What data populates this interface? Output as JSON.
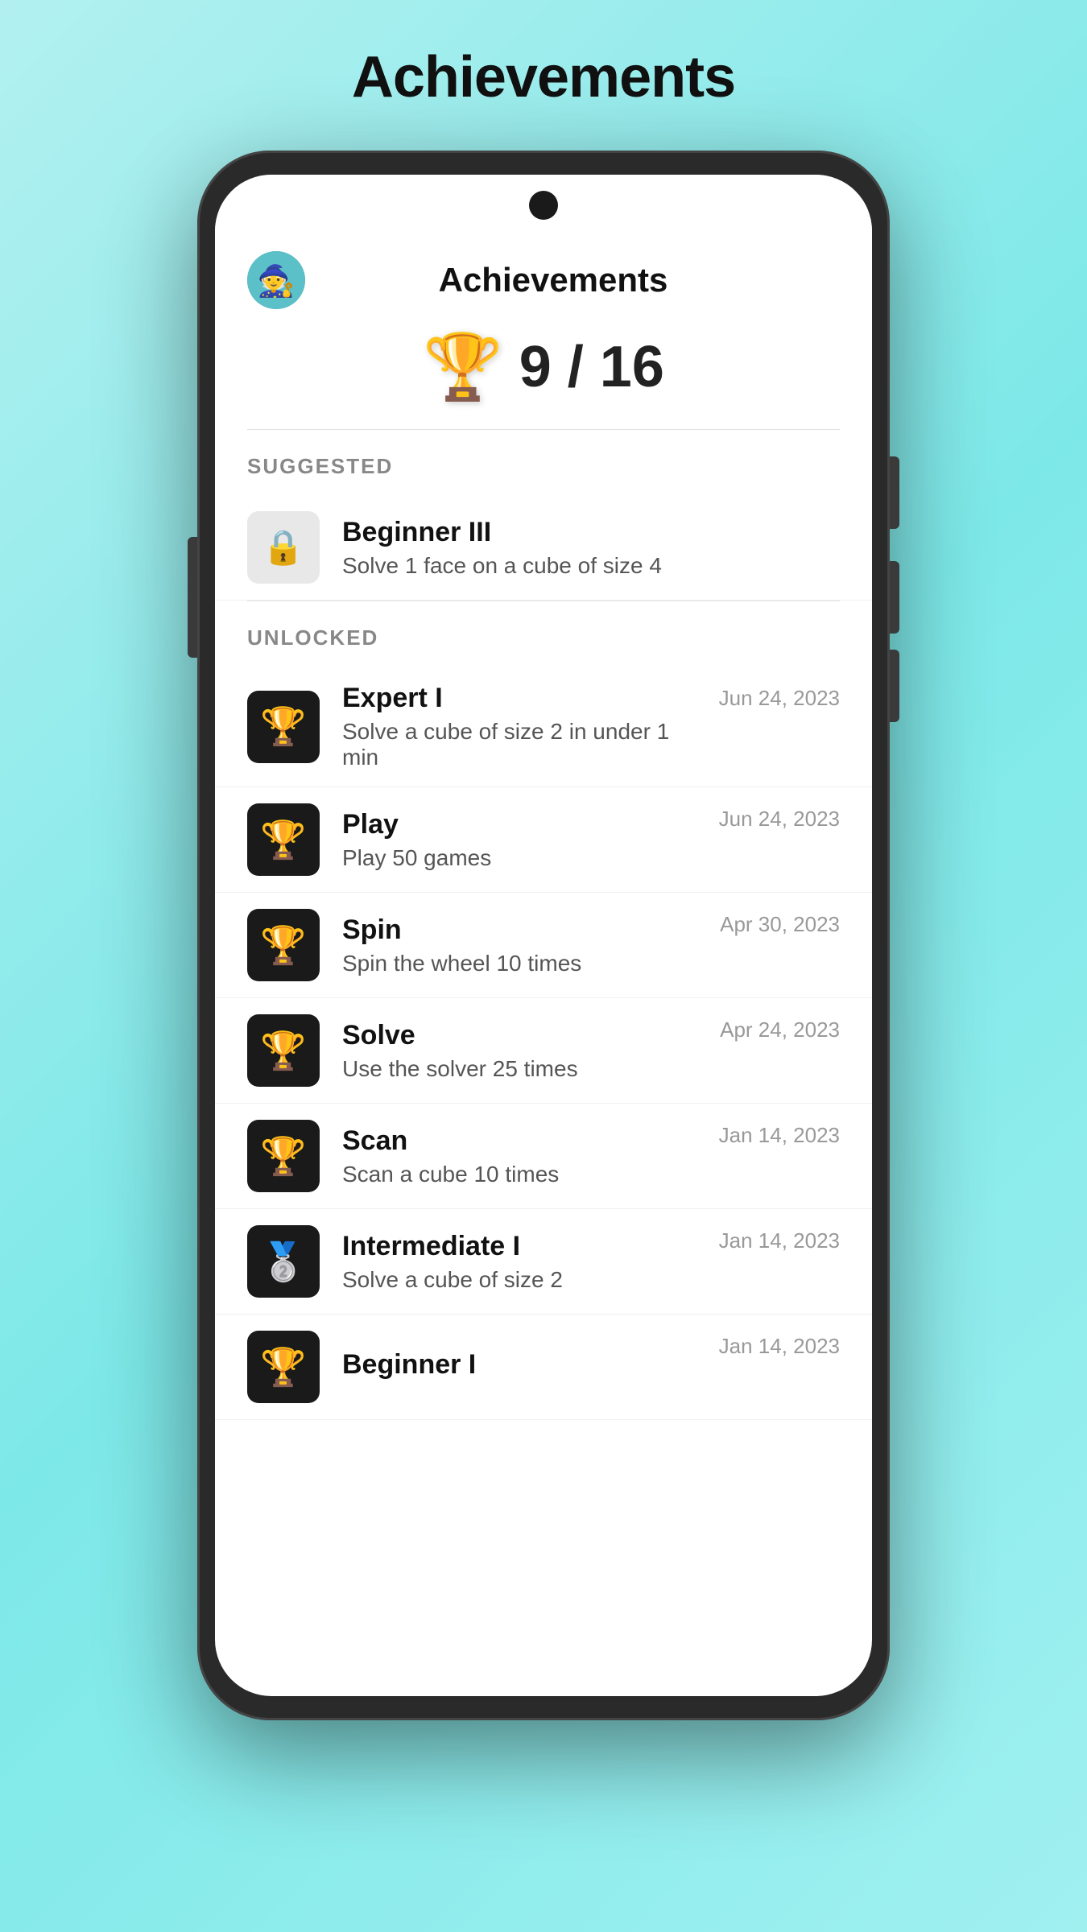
{
  "page": {
    "title": "Achievements"
  },
  "header": {
    "avatar_emoji": "🧙",
    "app_title": "Achievements",
    "score": "9 / 16",
    "trophy_emoji": "🏆"
  },
  "sections": [
    {
      "label": "SUGGESTED",
      "items": [
        {
          "id": "beginner-iii",
          "name": "Beginner III",
          "desc": "Solve 1 face on a cube of size 4",
          "date": "",
          "icon_type": "locked",
          "icon": "🔒"
        }
      ]
    },
    {
      "label": "UNLOCKED",
      "items": [
        {
          "id": "expert-i",
          "name": "Expert I",
          "desc": "Solve a cube of size 2 in under 1 min",
          "date": "Jun 24, 2023",
          "icon_type": "gold",
          "icon": "🏆"
        },
        {
          "id": "play",
          "name": "Play",
          "desc": "Play 50 games",
          "date": "Jun 24, 2023",
          "icon_type": "gold",
          "icon": "🏆"
        },
        {
          "id": "spin",
          "name": "Spin",
          "desc": "Spin the wheel 10 times",
          "date": "Apr 30, 2023",
          "icon_type": "gold",
          "icon": "🏆"
        },
        {
          "id": "solve",
          "name": "Solve",
          "desc": "Use the solver 25 times",
          "date": "Apr 24, 2023",
          "icon_type": "gold",
          "icon": "🏆"
        },
        {
          "id": "scan",
          "name": "Scan",
          "desc": "Scan a cube 10 times",
          "date": "Jan 14, 2023",
          "icon_type": "gold",
          "icon": "🏆"
        },
        {
          "id": "intermediate-i",
          "name": "Intermediate I",
          "desc": "Solve a cube of size 2",
          "date": "Jan 14, 2023",
          "icon_type": "silver",
          "icon": "🥈"
        },
        {
          "id": "beginner-i",
          "name": "Beginner I",
          "desc": "",
          "date": "Jan 14, 2023",
          "icon_type": "gold",
          "icon": "🏆"
        }
      ]
    }
  ]
}
